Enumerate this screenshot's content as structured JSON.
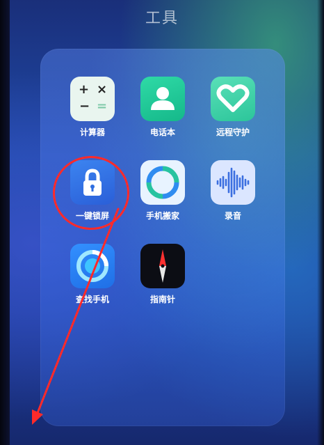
{
  "folder": {
    "title": "工具"
  },
  "apps": [
    {
      "id": "calculator",
      "label": "计算器",
      "icon": "calculator-icon"
    },
    {
      "id": "phonebook",
      "label": "电话本",
      "icon": "contact-person-icon"
    },
    {
      "id": "remote-guard",
      "label": "远程守护",
      "icon": "heart-icon"
    },
    {
      "id": "one-key-lock",
      "label": "一键锁屏",
      "icon": "lock-icon"
    },
    {
      "id": "phone-clone",
      "label": "手机搬家",
      "icon": "phone-clone-icon"
    },
    {
      "id": "recorder",
      "label": "录音",
      "icon": "sound-wave-icon"
    },
    {
      "id": "find-phone",
      "label": "查找手机",
      "icon": "radar-icon"
    },
    {
      "id": "compass",
      "label": "指南针",
      "icon": "compass-needle-icon"
    }
  ],
  "annotation": {
    "color": "#ff2a2a"
  }
}
